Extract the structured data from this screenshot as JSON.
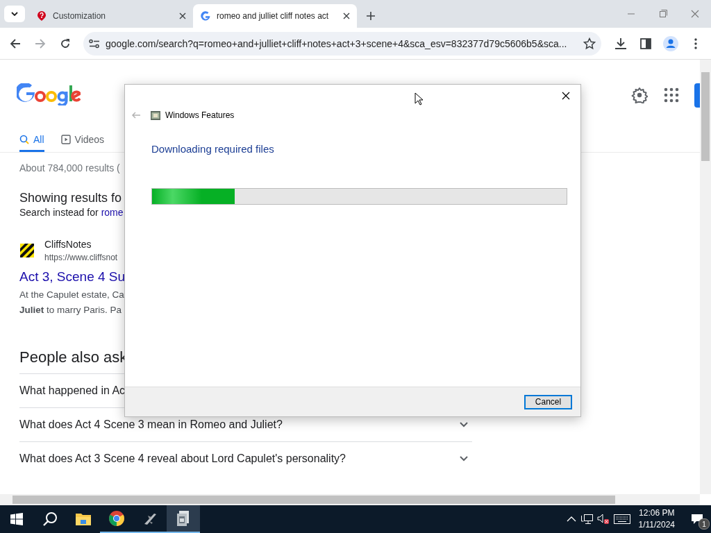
{
  "browser": {
    "tabs": [
      {
        "title": "Customization",
        "kind": "help",
        "selected": false
      },
      {
        "title": "romeo and julliet cliff notes act",
        "kind": "google",
        "selected": true
      }
    ],
    "address": "google.com/search?q=romeo+and+julliet+cliff+notes+act+3+scene+4&sca_esv=832377d79c5606b5&sca..."
  },
  "page": {
    "search_tabs": [
      {
        "label": "All",
        "kind": "search",
        "selected": true
      },
      {
        "label": "Videos",
        "kind": "video",
        "selected": false
      }
    ],
    "result_stats": "About 784,000 results (",
    "showing": "Showing results fo",
    "search_instead": "Search instead for",
    "search_instead_link": "rome",
    "result": {
      "site": "CliffsNotes",
      "url": "https://www.cliffsnot",
      "title": "Act 3, Scene 4 Su",
      "snippet": [
        "At the Capulet estate, Ca",
        "**Juliet** to marry Paris. Pa"
      ]
    },
    "people_also_ask": {
      "title": "People also ask",
      "questions": [
        {
          "text": "What happened in Ac"
        },
        {
          "text": "What does Act 4 Scene 3 mean in Romeo and Juliet?",
          "chevron": true
        },
        {
          "text": "What does Act 3 Scene 4 reveal about Lord Capulet's personality?",
          "chevron": true
        }
      ]
    }
  },
  "dialog": {
    "title": "Windows Features",
    "heading": "Downloading required files",
    "progress": {
      "level": 0.2
    },
    "buttons": [
      "Cancel"
    ]
  },
  "taskbar": {
    "apps": [
      {
        "kind": "explorer",
        "running": false,
        "selected": false
      },
      {
        "kind": "chrome",
        "running": true,
        "selected": false
      },
      {
        "kind": "plane",
        "running": true,
        "selected": false
      },
      {
        "kind": "features",
        "running": true,
        "selected": true
      }
    ],
    "time": "12:06 PM",
    "date": "1/11/2024",
    "notifications": "1"
  }
}
